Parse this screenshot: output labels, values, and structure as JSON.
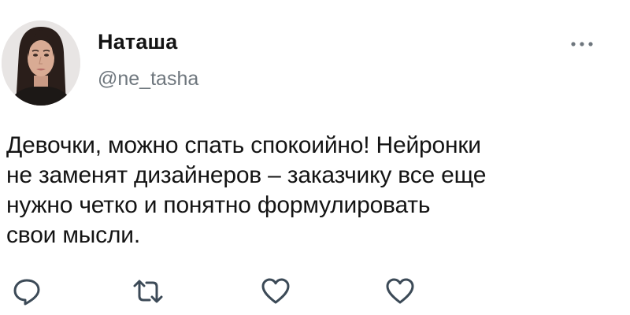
{
  "author": {
    "display_name": "Наташа",
    "handle": "@ne_tasha"
  },
  "tweet": {
    "lines": [
      "Девочки, можно спать спокоийно! Нейронки",
      "не заменят дизайнеров – заказчику все еще",
      "нужно четко и понятно формулировать",
      "свои мысли."
    ]
  },
  "icons": {
    "more": "more-horizontal-icon",
    "reply": "reply-icon",
    "retweet": "retweet-icon",
    "like": "heart-icon",
    "like_second": "heart-icon"
  },
  "colors": {
    "text": "#141414",
    "secondary": "#6e767d",
    "icon": "#3c4a57"
  }
}
